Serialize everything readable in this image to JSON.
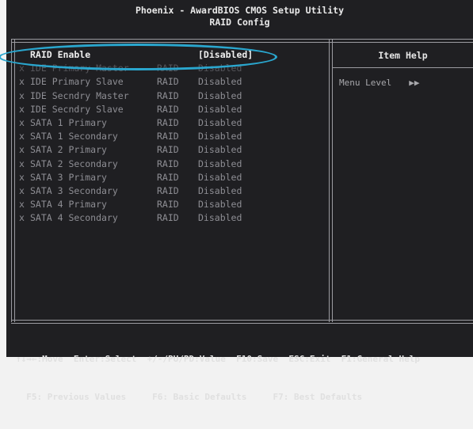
{
  "header": {
    "title": "Phoenix - AwardBIOS CMOS Setup Utility",
    "subtitle": "RAID Config"
  },
  "help": {
    "title": "Item Help",
    "menu_level_label": "Menu Level",
    "menu_level_arrows": "▶▶"
  },
  "items": [
    {
      "mark": "",
      "label": "RAID Enable",
      "col2": "",
      "value": "[Disabled]"
    },
    {
      "mark": "x",
      "label": "IDE Primary Master",
      "col2": "RAID",
      "value": "Disabled"
    },
    {
      "mark": "x",
      "label": "IDE Primary Slave",
      "col2": "RAID",
      "value": "Disabled"
    },
    {
      "mark": "x",
      "label": "IDE Secndry Master",
      "col2": "RAID",
      "value": "Disabled"
    },
    {
      "mark": "x",
      "label": "IDE Secndry Slave",
      "col2": "RAID",
      "value": "Disabled"
    },
    {
      "mark": "x",
      "label": "SATA 1 Primary",
      "col2": "RAID",
      "value": "Disabled"
    },
    {
      "mark": "x",
      "label": "SATA 1 Secondary",
      "col2": "RAID",
      "value": "Disabled"
    },
    {
      "mark": "x",
      "label": "SATA 2 Primary",
      "col2": "RAID",
      "value": "Disabled"
    },
    {
      "mark": "x",
      "label": "SATA 2 Secondary",
      "col2": "RAID",
      "value": "Disabled"
    },
    {
      "mark": "x",
      "label": "SATA 3 Primary",
      "col2": "RAID",
      "value": "Disabled"
    },
    {
      "mark": "x",
      "label": "SATA 3 Secondary",
      "col2": "RAID",
      "value": "Disabled"
    },
    {
      "mark": "x",
      "label": "SATA 4 Primary",
      "col2": "RAID",
      "value": "Disabled"
    },
    {
      "mark": "x",
      "label": "SATA 4 Secondary",
      "col2": "RAID",
      "value": "Disabled"
    }
  ],
  "footer": {
    "line1": "↑↓→←:Move  Enter:Select  +/-/PU/PD:Value  F10:Save  ESC:Exit  F1:General Help",
    "line2": "  F5: Previous Values     F6: Basic Defaults     F7: Best Defaults"
  },
  "colors": {
    "screen_bg": "#1f1f22",
    "highlight_ellipse": "#2aa7cf"
  }
}
